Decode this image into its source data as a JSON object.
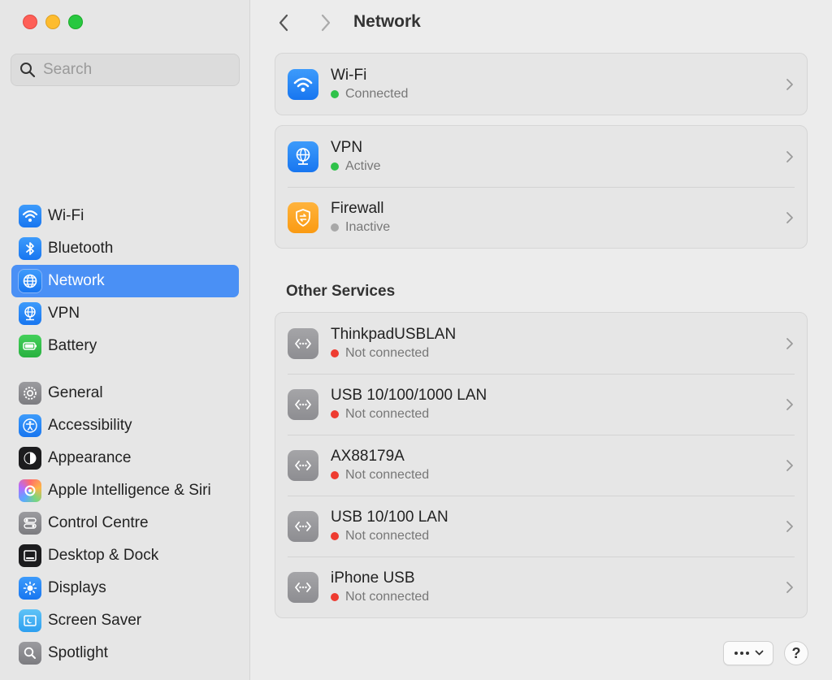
{
  "window": {
    "traffic_lights": [
      "close",
      "minimize",
      "zoom"
    ]
  },
  "search": {
    "placeholder": "Search"
  },
  "sidebar": {
    "group1": [
      {
        "label": "Wi-Fi",
        "icon": "wifi-icon",
        "color": "#1876f0"
      },
      {
        "label": "Bluetooth",
        "icon": "bluetooth-icon",
        "color": "#1876f0"
      },
      {
        "label": "Network",
        "icon": "globe-icon",
        "color": "#1876f0",
        "selected": true
      },
      {
        "label": "VPN",
        "icon": "vpn-globe-icon",
        "color": "#1876f0"
      },
      {
        "label": "Battery",
        "icon": "battery-icon",
        "color": "#29b140"
      }
    ],
    "group2": [
      {
        "label": "General",
        "icon": "gear-icon",
        "color": "#7c7c80"
      },
      {
        "label": "Accessibility",
        "icon": "accessibility-icon",
        "color": "#1876f0"
      },
      {
        "label": "Appearance",
        "icon": "appearance-icon",
        "color": "#1c1c1e"
      },
      {
        "label": "Apple Intelligence & Siri",
        "icon": "siri-icon",
        "color": "#b36bff"
      },
      {
        "label": "Control Centre",
        "icon": "control-centre-icon",
        "color": "#7c7c80"
      },
      {
        "label": "Desktop & Dock",
        "icon": "dock-icon",
        "color": "#1c1c1e"
      },
      {
        "label": "Displays",
        "icon": "sun-icon",
        "color": "#1876f0"
      },
      {
        "label": "Screen Saver",
        "icon": "screen-saver-icon",
        "color": "#2d9ff0"
      },
      {
        "label": "Spotlight",
        "icon": "magnifier-icon",
        "color": "#7c7c80"
      }
    ]
  },
  "header": {
    "title": "Network"
  },
  "main": {
    "wifi": {
      "title": "Wi-Fi",
      "status": "Connected",
      "status_color": "#2fc24a"
    },
    "security": [
      {
        "title": "VPN",
        "status": "Active",
        "status_color": "#2fc24a",
        "icon": "vpn-globe-icon"
      },
      {
        "title": "Firewall",
        "status": "Inactive",
        "status_color": "#a8a8a8",
        "icon": "firewall-shield-icon"
      }
    ],
    "other_services_title": "Other Services",
    "services": [
      {
        "title": "ThinkpadUSBLAN",
        "status": "Not connected",
        "status_color": "#ee3b30"
      },
      {
        "title": "USB 10/100/1000 LAN",
        "status": "Not connected",
        "status_color": "#ee3b30"
      },
      {
        "title": "AX88179A",
        "status": "Not connected",
        "status_color": "#ee3b30"
      },
      {
        "title": "USB 10/100 LAN",
        "status": "Not connected",
        "status_color": "#ee3b30"
      },
      {
        "title": "iPhone USB",
        "status": "Not connected",
        "status_color": "#ee3b30"
      }
    ]
  },
  "footer": {
    "help_label": "?"
  }
}
